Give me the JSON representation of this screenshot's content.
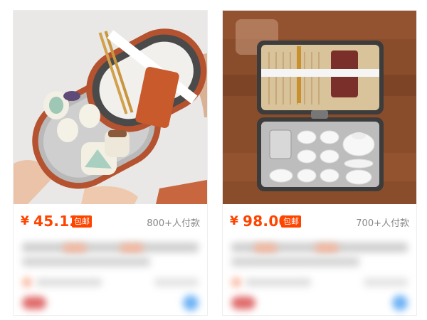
{
  "products": [
    {
      "currency": "¥",
      "price": "45.12",
      "badge": "包邮",
      "sold": "800+人付款",
      "image_alt": "portable travel tea set in rounded carrying case"
    },
    {
      "currency": "¥",
      "price": "98.00",
      "badge": "包邮",
      "sold": "700+人付款",
      "image_alt": "travel tea set in rectangular case with bamboo tray"
    }
  ],
  "colors": {
    "price": "#ff4400",
    "badge_bg": "#ff4400",
    "sold_text": "#888888"
  }
}
